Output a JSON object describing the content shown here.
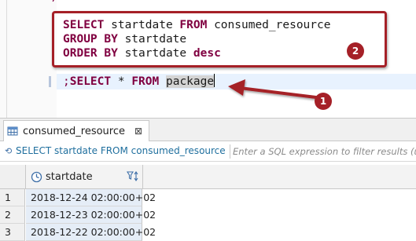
{
  "editor": {
    "top_fragment": ";",
    "callout_query": {
      "line1": {
        "kw": "SELECT",
        "rest1": " startdate ",
        "kw2": "FROM",
        "rest2": " consumed_resource"
      },
      "line2": {
        "kw": "GROUP BY",
        "rest": " startdate"
      },
      "line3": {
        "kw": "ORDER BY",
        "rest": " startdate ",
        "kw2": "desc"
      }
    },
    "current_query": {
      "semicolon": ";",
      "kw1": "SELECT",
      "star": " * ",
      "kw2": "FROM",
      "space": " ",
      "table": "package"
    },
    "badges": {
      "box": "2",
      "arrow": "1"
    },
    "accent_color": "#a52027"
  },
  "results": {
    "tab_label": "consumed_resource",
    "tab_close": "⊠",
    "filter_query": "SELECT startdate FROM consumed_resource",
    "filter_placeholder": "Enter a SQL expression to filter results (use Ctrl+Space)",
    "columns": [
      {
        "name": "startdate",
        "icon": "clock-icon"
      }
    ],
    "rows": [
      {
        "num": "1",
        "startdate": "2018-12-24 02:00:00+02"
      },
      {
        "num": "2",
        "startdate": "2018-12-23 02:00:00+02"
      },
      {
        "num": "3",
        "startdate": "2018-12-22 02:00:00+02"
      }
    ]
  }
}
